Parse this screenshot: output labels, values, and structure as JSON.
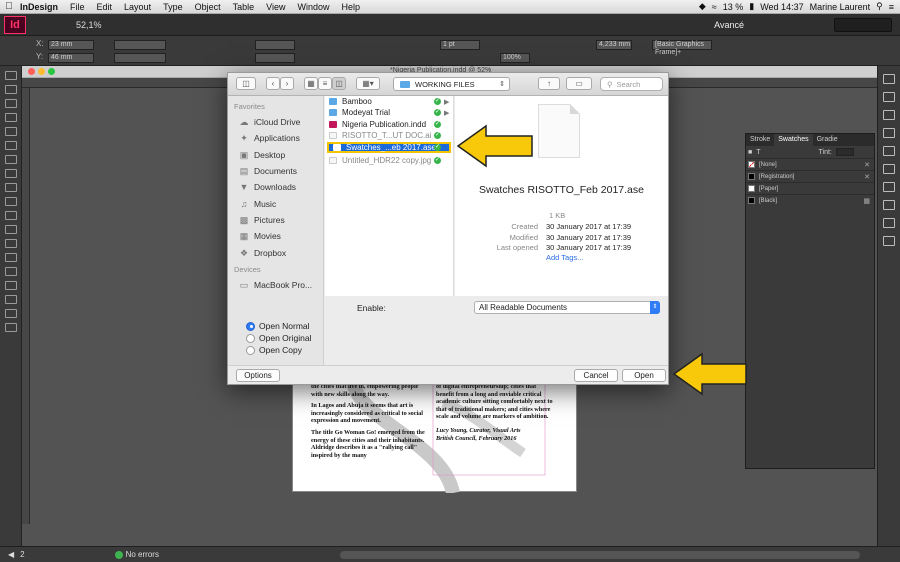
{
  "menubar": {
    "items": [
      "InDesign",
      "File",
      "Edit",
      "Layout",
      "Type",
      "Object",
      "Table",
      "View",
      "Window",
      "Help"
    ],
    "battery": "13 %",
    "clock": "Wed 14:37",
    "user": "Marine Laurent"
  },
  "appbar": {
    "logo": "Id",
    "zoom": "52,1%",
    "workspace": "Avancé"
  },
  "controlbar": {
    "x_value": "23 mm",
    "y_value": "46 mm",
    "stroke_weight": "1 pt",
    "width_value": "4,233 mm",
    "percent": "100%",
    "style_name": "[Basic Graphics Frame]+"
  },
  "document_tab": {
    "title": "*Nigeria Publication.indd @ 52%"
  },
  "dialog": {
    "path": "WORKING FILES",
    "search_placeholder": "Search",
    "sidebar": {
      "favorites_heading": "Favorites",
      "favorites": [
        {
          "label": "iCloud Drive",
          "icon": "cloud-icon"
        },
        {
          "label": "Applications",
          "icon": "applications-icon"
        },
        {
          "label": "Desktop",
          "icon": "desktop-icon"
        },
        {
          "label": "Documents",
          "icon": "documents-icon"
        },
        {
          "label": "Downloads",
          "icon": "downloads-icon"
        },
        {
          "label": "Music",
          "icon": "music-icon"
        },
        {
          "label": "Pictures",
          "icon": "pictures-icon"
        },
        {
          "label": "Movies",
          "icon": "movies-icon"
        },
        {
          "label": "Dropbox",
          "icon": "dropbox-icon"
        }
      ],
      "devices_heading": "Devices",
      "devices": [
        {
          "label": "MacBook Pro...",
          "icon": "laptop-icon"
        }
      ]
    },
    "files": [
      {
        "name": "Bamboo",
        "kind": "folder",
        "checked": true,
        "arrow": true
      },
      {
        "name": "Modeyat Trial",
        "kind": "folder",
        "checked": true,
        "arrow": true
      },
      {
        "name": "Nigeria Publication.indd",
        "kind": "indd",
        "checked": true,
        "arrow": false
      },
      {
        "name": "RISOTTO_T...UT DOC.ai",
        "kind": "ai",
        "checked": true,
        "arrow": false
      },
      {
        "name": "Swatches_...eb 2017.ase",
        "kind": "ase",
        "checked": true,
        "arrow": false,
        "selected": true
      },
      {
        "name": "Untitled_HDR22 copy.jpg",
        "kind": "jpg",
        "checked": true,
        "arrow": false
      }
    ],
    "preview": {
      "filename": "Swatches RISOTTO_Feb 2017.ase",
      "size": "1 KB",
      "created_label": "Created",
      "created": "30 January 2017 at 17:39",
      "modified_label": "Modified",
      "modified": "30 January 2017 at 17:39",
      "last_opened_label": "Last opened",
      "last_opened": "30 January 2017 at 17:39",
      "add_tags": "Add Tags..."
    },
    "enable_label": "Enable:",
    "enable_value": "All Readable Documents",
    "open_options": [
      "Open Normal",
      "Open Original",
      "Open Copy"
    ],
    "open_selected": "Open Normal",
    "options_button": "Options",
    "cancel_button": "Cancel",
    "open_button": "Open"
  },
  "swatches_panel": {
    "tabs": [
      "Stroke",
      "Swatches",
      "Gradie"
    ],
    "tint_label": "Tint:",
    "swatches": [
      {
        "name": "[None]",
        "color": "#ffffff",
        "none": true
      },
      {
        "name": "[Registration]",
        "color": "#000000"
      },
      {
        "name": "[Paper]",
        "color": "#ffffff"
      },
      {
        "name": "[Black]",
        "color": "#000000"
      }
    ]
  },
  "page_text": {
    "col1": [
      "the cities that live in, empowering people with new skills along the way.",
      "In Lagos and Abuja it seems that art is increasingly considered as critical to social expression and movement.",
      "The title Go Woman Go! emerged from the energy of these cities and their inhabitants. Aldridge describes it as a \"rallying call\" inspired by the many"
    ],
    "col2": [
      "of digital entrepreneurship; cities that benefit from a long and enviable critical academic culture sitting comfortably next to that of traditional makers; and cities where scale and volume are markers of ambition.",
      "Lucy Young, Curator, Visual Arts",
      "British Council, February 2016"
    ]
  },
  "statusbar": {
    "page": "2",
    "errors": "No errors"
  },
  "colors": {
    "accent": "#2f7cf6",
    "highlight": "#f5c400",
    "arrow": "#f7c90a"
  }
}
